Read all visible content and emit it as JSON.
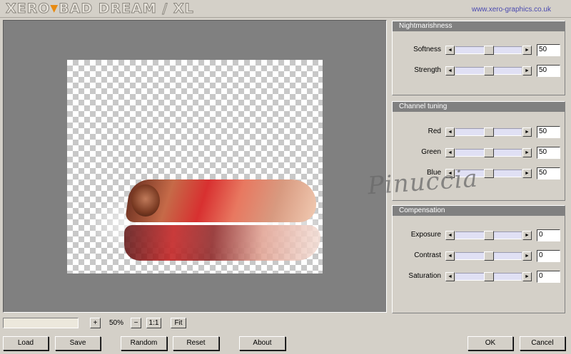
{
  "header": {
    "logo_text": "XERO",
    "logo_separator": "▼",
    "logo_title": "BAD DREAM / XL",
    "url": "www.xero-graphics.co.uk"
  },
  "watermark": "Pinuccia",
  "panels": [
    {
      "title": "Nightmarishness",
      "sliders": [
        {
          "label": "Softness",
          "value": "50",
          "level": 0.5
        },
        {
          "label": "Strength",
          "value": "50",
          "level": 0.5
        }
      ]
    },
    {
      "title": "Channel tuning",
      "sliders": [
        {
          "label": "Red",
          "value": "50",
          "level": 0.5
        },
        {
          "label": "Green",
          "value": "50",
          "level": 0.5
        },
        {
          "label": "Blue",
          "value": "50",
          "level": 0.5
        }
      ]
    },
    {
      "title": "Compensation",
      "sliders": [
        {
          "label": "Exposure",
          "value": "0",
          "level": 0.5
        },
        {
          "label": "Contrast",
          "value": "0",
          "level": 0.5
        },
        {
          "label": "Saturation",
          "value": "0",
          "level": 0.5
        }
      ]
    }
  ],
  "zoom": {
    "plus": "+",
    "value": "50%",
    "minus": "−",
    "one_to_one": "1:1",
    "fit": "Fit"
  },
  "buttons": {
    "load": "Load",
    "save": "Save",
    "random": "Random",
    "reset": "Reset",
    "about": "About",
    "ok": "OK",
    "cancel": "Cancel"
  },
  "icons": {
    "left_arrow": "◄",
    "right_arrow": "►"
  }
}
